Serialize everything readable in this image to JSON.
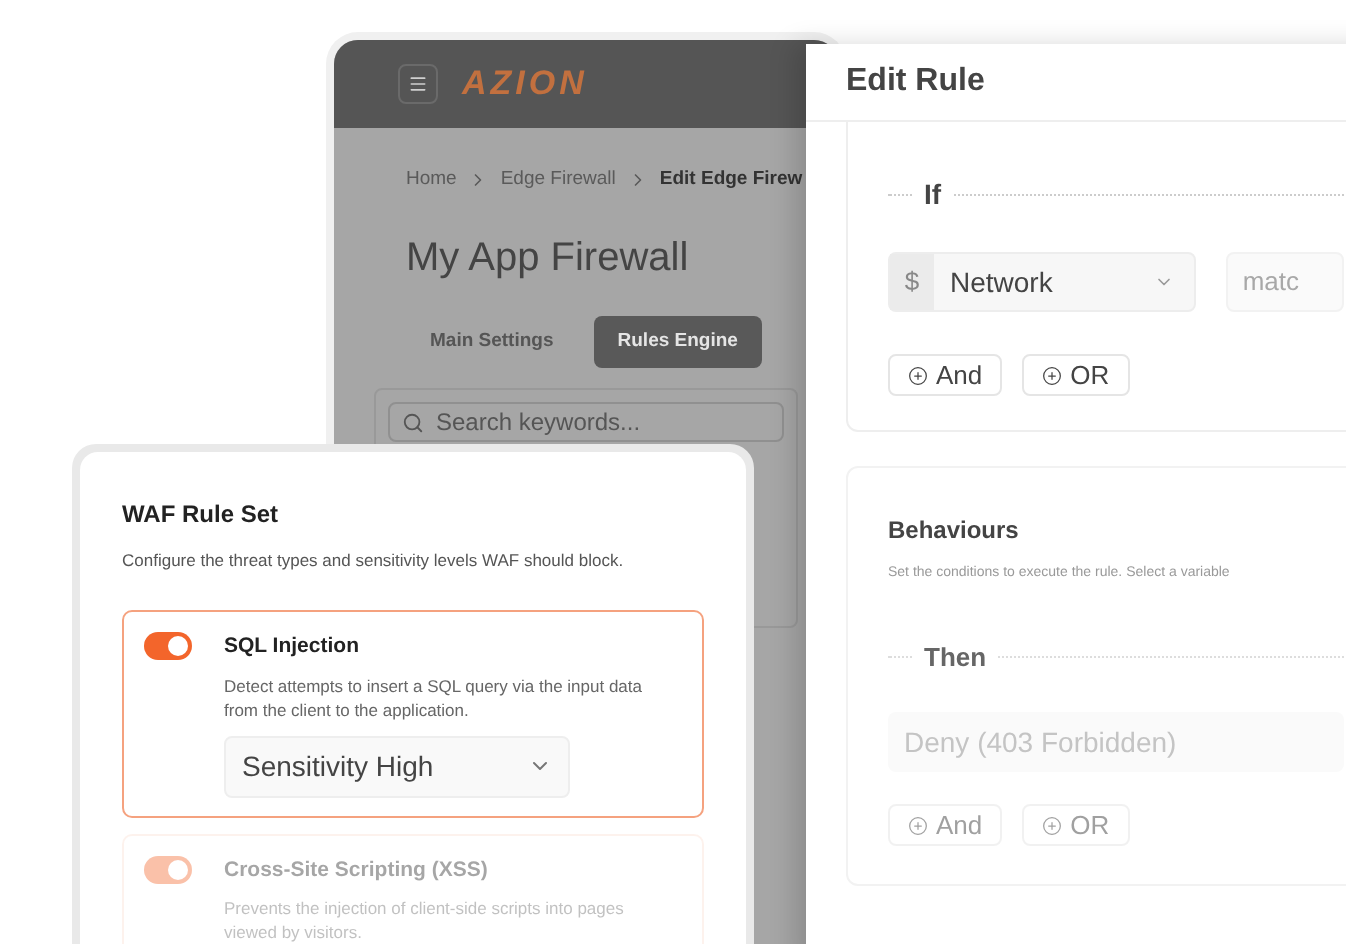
{
  "app_window": {
    "logo": "AZION",
    "breadcrumb": [
      "Home",
      "Edge Firewall",
      "Edit Edge Firew"
    ],
    "title": "My App Firewall",
    "tabs": [
      {
        "label": "Main Settings",
        "selected": false
      },
      {
        "label": "Rules Engine",
        "selected": true
      }
    ],
    "search": {
      "placeholder": "Search keywords..."
    }
  },
  "edit_rule": {
    "title": "Edit Rule",
    "condition": {
      "heading": "If",
      "prefix": "$",
      "variable": "Network",
      "operator": "matc",
      "buttons": [
        "And",
        "OR"
      ]
    },
    "behaviours": {
      "heading": "Behaviours",
      "description": "Set the conditions to execute the rule. Select a variable",
      "then": "Then",
      "action": "Deny (403 Forbidden)",
      "buttons": [
        "And",
        "OR"
      ]
    }
  },
  "waf_rule_set": {
    "title": "WAF Rule Set",
    "description": "Configure the threat types and sensitivity levels WAF should block.",
    "rules": [
      {
        "title": "SQL Injection",
        "description": "Detect attempts to insert a SQL query via the input data from the client to the application.",
        "on": true,
        "selected": true,
        "sensitivity": "Sensitivity High"
      },
      {
        "title": "Cross-Site Scripting (XSS)",
        "description": "Prevents the injection of client-side scripts into pages viewed by visitors.",
        "on": true,
        "selected": false
      }
    ]
  }
}
